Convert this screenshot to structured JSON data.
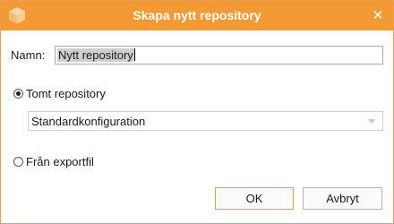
{
  "window": {
    "title": "Skapa nytt repository",
    "accent": "#f39a35"
  },
  "form": {
    "name_label": "Namn:",
    "name_value": "Nytt repository",
    "empty_option": {
      "label": "Tomt repository",
      "checked": true
    },
    "config_select": {
      "selected": "Standardkonfiguration"
    },
    "export_option": {
      "label": "Från exportfil",
      "checked": false
    }
  },
  "buttons": {
    "ok": "OK",
    "cancel": "Avbryt"
  },
  "icons": {
    "app": "cube-icon",
    "close": "close-icon"
  }
}
